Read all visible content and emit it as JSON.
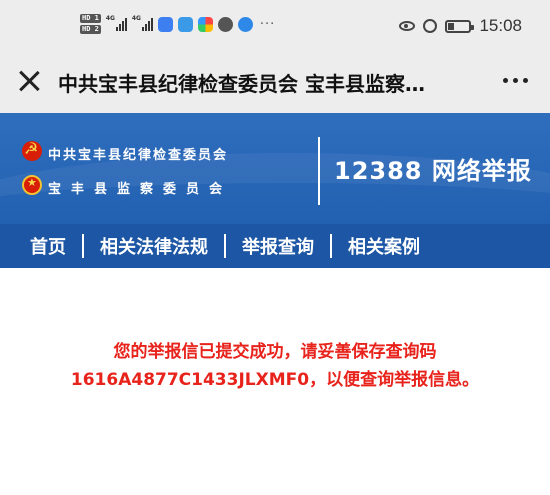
{
  "status_bar": {
    "sim1": "HD 1",
    "sim2": "HD 2",
    "net1": "4G",
    "net2": "4G",
    "more": "···",
    "time": "15:08",
    "icons": [
      "eye-icon",
      "alarm-icon",
      "battery-icon"
    ]
  },
  "title_bar": {
    "title": "中共宝丰县纪律检查委员会 宝丰县监察…",
    "close_icon": "close-icon",
    "more_icon": "more-icon"
  },
  "banner": {
    "org_line_1": "中共宝丰县纪律检查委员会",
    "org_line_2": "宝丰县监察委员会",
    "hotline": "12388 网络举报",
    "colors": {
      "banner_blue": "#2a66b6",
      "nav_blue": "#1c56a4"
    }
  },
  "nav": {
    "items": [
      {
        "label": "首页"
      },
      {
        "label": "相关法律法规"
      },
      {
        "label": "举报查询"
      },
      {
        "label": "相关案例"
      }
    ]
  },
  "main": {
    "message_line_1": "您的举报信已提交成功，请妥善保存查询码",
    "message_line_2": "1616A4877C1433JLXMF0，以便查询举报信息。",
    "message_color": "#e8231c"
  }
}
